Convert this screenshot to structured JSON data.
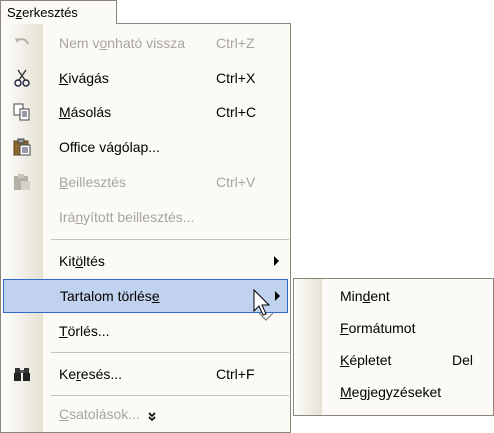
{
  "menubar": {
    "tab_prefix": "S",
    "tab_ul": "z",
    "tab_suffix": "erkesztés"
  },
  "menu": {
    "undo": {
      "a": "Nem v",
      "u": "o",
      "b": "nható vissza",
      "shortcut": "Ctrl+Z",
      "icon": "undo-icon"
    },
    "cut": {
      "a": "",
      "u": "K",
      "b": "ivágás",
      "shortcut": "Ctrl+X",
      "icon": "scissors-icon"
    },
    "copy": {
      "a": "",
      "u": "M",
      "b": "ásolás",
      "shortcut": "Ctrl+C",
      "icon": "copy-icon"
    },
    "clipboard": {
      "a": "Office vá",
      "u": "g",
      "b": "ólap...",
      "icon": "clipboard-icon"
    },
    "paste": {
      "a": "",
      "u": "B",
      "b": "eillesztés",
      "shortcut": "Ctrl+V",
      "icon": "paste-icon"
    },
    "paste_special": {
      "a": "Irá",
      "u": "n",
      "b": "yított beillesztés..."
    },
    "fill": {
      "a": "Kit",
      "u": "ö",
      "b": "ltés"
    },
    "clear": {
      "a": "Tartalom törlés",
      "u": "e",
      "b": ""
    },
    "delete": {
      "a": "",
      "u": "T",
      "b": "örlés..."
    },
    "find": {
      "a": "Ke",
      "u": "r",
      "b": "esés...",
      "shortcut": "Ctrl+F",
      "icon": "binoculars-icon"
    },
    "links": {
      "a": "",
      "u": "C",
      "b": "satolások..."
    },
    "expand_glyph": "¥"
  },
  "submenu": {
    "all": {
      "a": "Min",
      "u": "d",
      "b": "ent"
    },
    "formats": {
      "a": "",
      "u": "F",
      "b": "ormátumot"
    },
    "formulas": {
      "a": "",
      "u": "K",
      "b": "épletet",
      "shortcut": "Del"
    },
    "comments": {
      "a": "",
      "u": "M",
      "b": "egjegyzéseket"
    }
  },
  "colors": {
    "highlight_bg": "#c1d2ee",
    "highlight_border": "#316ac5",
    "disabled_text": "#a7a59c"
  }
}
